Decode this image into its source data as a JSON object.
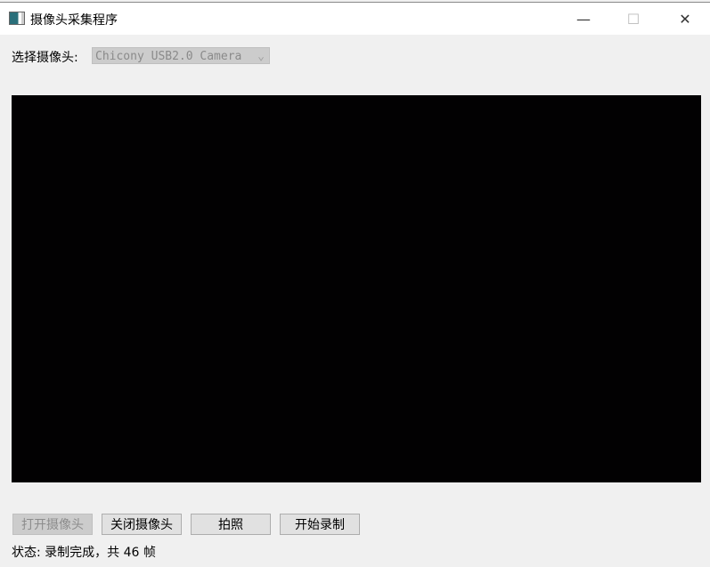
{
  "window": {
    "title": "摄像头采集程序",
    "minimize": "—",
    "maximize": "☐",
    "close": "✕"
  },
  "camera": {
    "label": "选择摄像头:",
    "selected": "Chicony USB2.0 Camera"
  },
  "buttons": {
    "open": "打开摄像头",
    "close": "关闭摄像头",
    "photo": "拍照",
    "record": "开始录制"
  },
  "status": "状态: 录制完成，共 46 帧"
}
